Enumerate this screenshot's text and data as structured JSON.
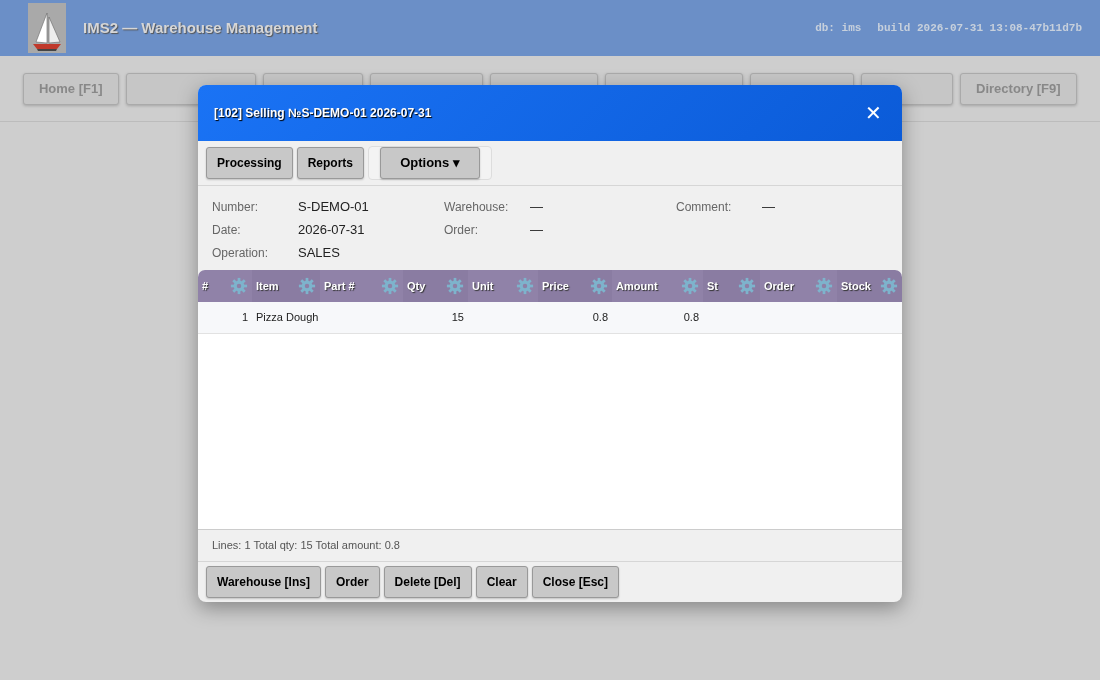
{
  "app": {
    "title": "IMS2 — Warehouse Management",
    "db": "db: ims",
    "build": "build 2026-07-31 13:08-47b11d7b"
  },
  "nav": [
    {
      "label": "Home [F1]",
      "kind": "first"
    },
    {
      "label": "Directory [F9]",
      "kind": "last"
    }
  ],
  "dialog": {
    "title": "[102] Selling №S-DEMO-01 2026-07-31",
    "close": "✕",
    "toolbar": [
      {
        "label": "Processing",
        "kind": "button"
      },
      {
        "label": "Reports",
        "kind": "button"
      },
      {
        "label": "Options ▾",
        "kind": "dropdown"
      }
    ],
    "fields": [
      [
        {
          "label": "Number:",
          "value": "S-DEMO-01"
        },
        {
          "label": "Date:",
          "value": "2026-07-31"
        },
        {
          "label": "Operation:",
          "value": "SALES"
        }
      ],
      [
        {
          "label": "Warehouse:",
          "value": "—"
        },
        {
          "label": "Order:",
          "value": "—"
        }
      ],
      [
        {
          "label": "Comment:",
          "value": "—"
        }
      ]
    ],
    "table": {
      "columns": [
        "#",
        "Item",
        "Part #",
        "Qty",
        "Unit",
        "Price",
        "Amount",
        "St",
        "Order",
        "Stock"
      ],
      "rows": [
        [
          "1",
          "Pizza Dough",
          "",
          "15",
          "",
          "0.8",
          "0.8",
          "",
          "",
          ""
        ]
      ]
    },
    "summary": "Lines: 1 Total qty: 15 Total amount: 0.8",
    "buttons": [
      "Warehouse [Ins]",
      "Order",
      "Delete [Del]",
      "Clear",
      "Close [Esc]"
    ]
  }
}
